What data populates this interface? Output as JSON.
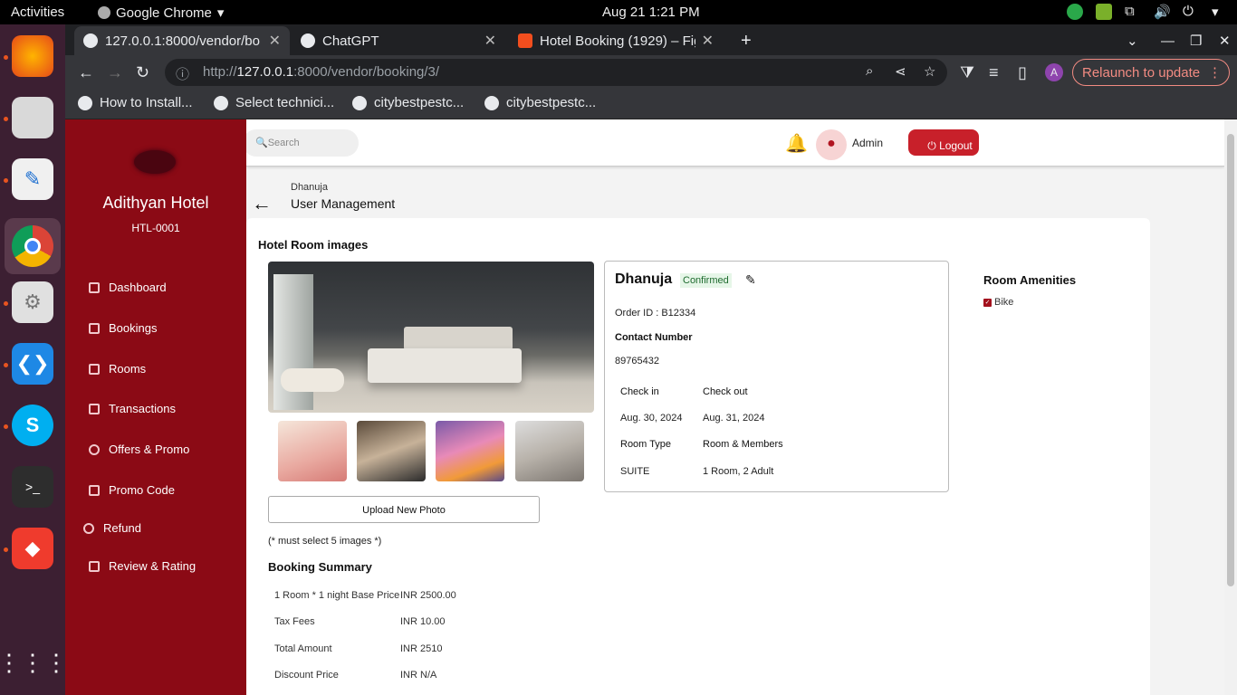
{
  "os": {
    "activities": "Activities",
    "app_name": "Google Chrome",
    "clock": "Aug 21  1:21 PM"
  },
  "browser": {
    "tabs": [
      {
        "label": "127.0.0.1:8000/vendor/bo"
      },
      {
        "label": "ChatGPT"
      },
      {
        "label": "Hotel Booking (1929) – Fig"
      }
    ],
    "url_prefix": "http://",
    "url_host": "127.0.0.1",
    "url_rest": ":8000/vendor/booking/3/",
    "relaunch": "Relaunch to update",
    "profile_letter": "A",
    "bookmarks": [
      {
        "label": "How to Install..."
      },
      {
        "label": "Select technici..."
      },
      {
        "label": "citybestpestc..."
      },
      {
        "label": "citybestpestc..."
      }
    ]
  },
  "sidebar": {
    "hotel_name": "Adithyan Hotel",
    "hotel_code": "HTL-0001",
    "items": [
      {
        "label": "Dashboard"
      },
      {
        "label": "Bookings"
      },
      {
        "label": "Rooms"
      },
      {
        "label": "Transactions"
      },
      {
        "label": "Offers & Promo"
      },
      {
        "label": "Promo Code"
      },
      {
        "label": "Refund"
      },
      {
        "label": "Review & Rating"
      }
    ]
  },
  "header": {
    "search_placeholder": "Search",
    "user": "Admin",
    "logout": "Logout"
  },
  "breadcrumb": {
    "parent": "Dhanuja",
    "current": "User Management"
  },
  "images": {
    "title": "Hotel Room images",
    "upload": "Upload New Photo",
    "note": "(* must select 5 images *)"
  },
  "booking": {
    "name": "Dhanuja",
    "status": "Confirmed",
    "order_id": "Order ID : B12334",
    "contact_label": "Contact Number",
    "contact_value": "89765432",
    "checkin_label": "Check in",
    "checkout_label": "Check out",
    "checkin_value": "Aug. 30, 2024",
    "checkout_value": "Aug. 31, 2024",
    "roomtype_label": "Room Type",
    "members_label": "Room & Members",
    "roomtype_value": "SUITE",
    "members_value": "1 Room, 2 Adult"
  },
  "amenities": {
    "title": "Room Amenities",
    "items": [
      {
        "label": "Bike",
        "checked": true
      }
    ]
  },
  "summary": {
    "title": "Booking Summary",
    "rows": [
      {
        "label": "1 Room * 1 night Base Price",
        "value": "INR 2500.00"
      },
      {
        "label": "Tax Fees",
        "value": "INR 10.00"
      },
      {
        "label": "Total Amount",
        "value": "INR 2510"
      },
      {
        "label": "Discount Price",
        "value": "INR N/A"
      }
    ]
  },
  "colors": {
    "sidebar": "#8b0a15",
    "logout": "#c8202a",
    "status_text": "#1e6b2e",
    "status_bg": "#e6f6e8"
  }
}
